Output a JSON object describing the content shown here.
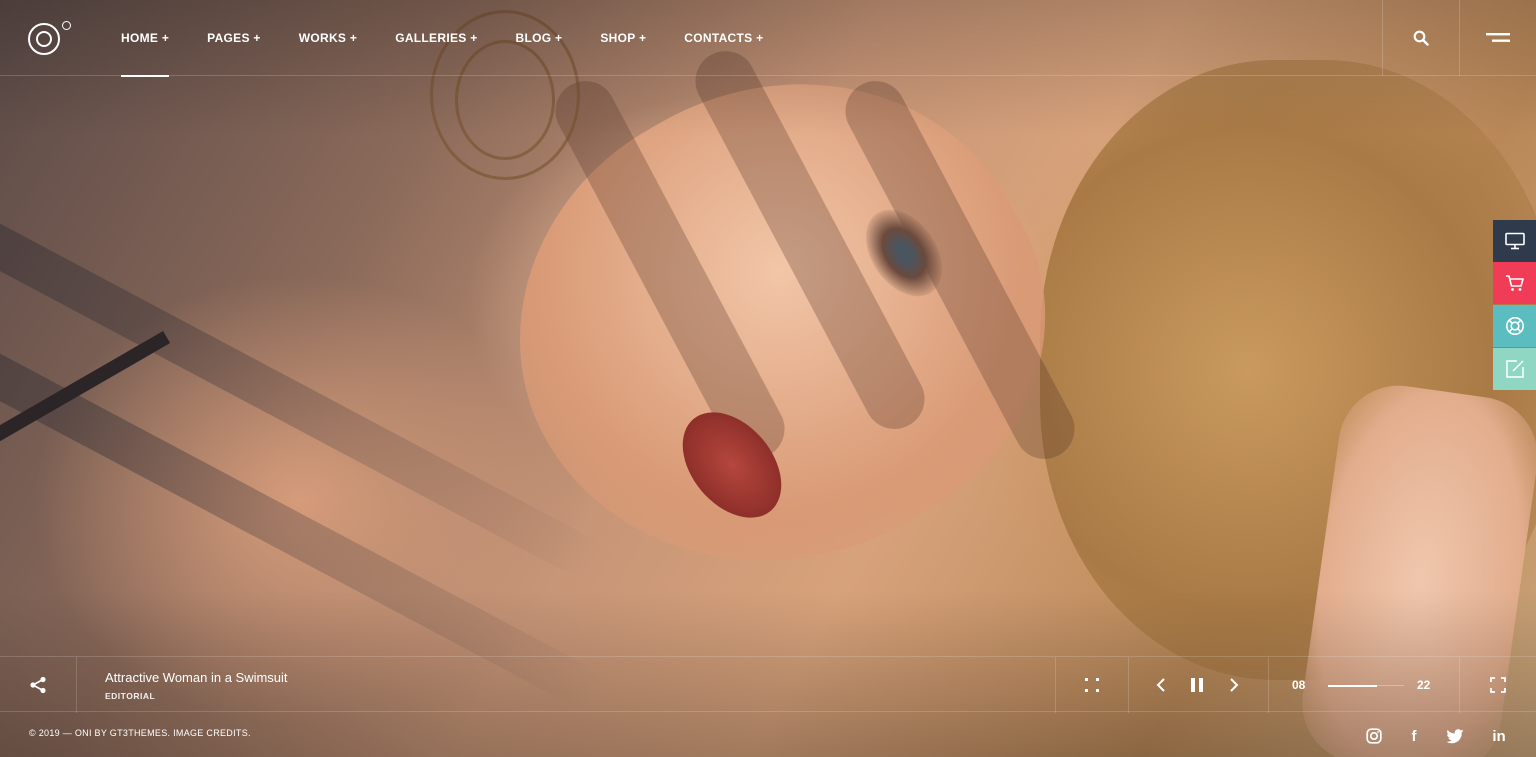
{
  "header": {
    "nav": [
      {
        "label": "HOME +",
        "active": true
      },
      {
        "label": "PAGES +",
        "active": false
      },
      {
        "label": "WORKS +",
        "active": false
      },
      {
        "label": "GALLERIES +",
        "active": false
      },
      {
        "label": "BLOG +",
        "active": false
      },
      {
        "label": "SHOP +",
        "active": false
      },
      {
        "label": "CONTACTS +",
        "active": false
      }
    ],
    "search_icon": "search-icon",
    "menu_icon": "hamburger-menu-icon"
  },
  "side_buttons": [
    {
      "icon": "monitor-icon",
      "color": "#2f3a4d"
    },
    {
      "icon": "cart-icon",
      "color": "#f03c57"
    },
    {
      "icon": "lifebuoy-icon",
      "color": "#5bbdc0"
    },
    {
      "icon": "edit-icon",
      "color": "#8fd7c2"
    }
  ],
  "slide": {
    "title": "Attractive Woman in a Swimsuit",
    "category": "EDITORIAL",
    "current": "08",
    "total": "22",
    "progress": 0.64
  },
  "controls": {
    "share_icon": "share-icon",
    "grid_icon": "grid-dots-icon",
    "prev_icon": "chevron-left-icon",
    "pause_icon": "pause-icon",
    "next_icon": "chevron-right-icon",
    "fullscreen_icon": "fullscreen-icon"
  },
  "footer": {
    "copyright": "© 2019 — ONI BY GT3THEMES. IMAGE CREDITS.",
    "social": [
      {
        "icon": "instagram-icon"
      },
      {
        "icon": "facebook-icon",
        "glyph": "f"
      },
      {
        "icon": "twitter-icon"
      },
      {
        "icon": "linkedin-icon",
        "glyph": "in"
      }
    ]
  }
}
